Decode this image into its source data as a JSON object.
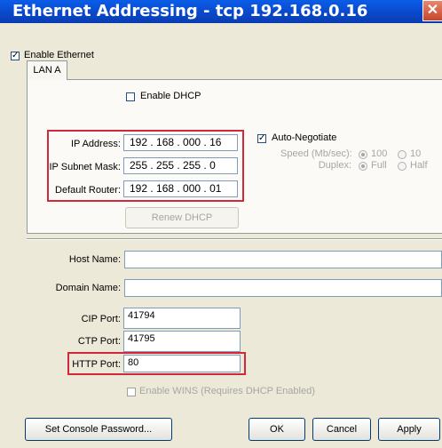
{
  "window": {
    "title": "Ethernet Addressing - tcp 192.168.0.16",
    "close_glyph": "✕"
  },
  "enable_ethernet": {
    "label": "Enable Ethernet",
    "checked": true
  },
  "tab": {
    "label": "LAN A"
  },
  "dhcp": {
    "label": "Enable DHCP",
    "checked": false
  },
  "ip_address": {
    "label": "IP Address:",
    "value": "192 . 168 . 000 . 16"
  },
  "subnet_mask": {
    "label": "IP Subnet Mask:",
    "value": "255 . 255 . 255 . 0"
  },
  "default_router": {
    "label": "Default Router:",
    "value": "192 . 168 . 000 . 01"
  },
  "renew_dhcp": {
    "label": "Renew DHCP"
  },
  "auto_negotiate": {
    "label": "Auto-Negotiate",
    "checked": true
  },
  "speed": {
    "label": "Speed (Mb/sec):",
    "options": [
      "100",
      "10"
    ],
    "selected": "100"
  },
  "duplex": {
    "label": "Duplex:",
    "options": [
      "Full",
      "Half"
    ],
    "selected": "Full"
  },
  "host_name": {
    "label": "Host Name:",
    "value": ""
  },
  "domain_name": {
    "label": "Domain Name:",
    "value": ""
  },
  "cip_port": {
    "label": "CIP Port:",
    "value": "41794"
  },
  "ctp_port": {
    "label": "CTP Port:",
    "value": "41795"
  },
  "http_port": {
    "label": "HTTP Port:",
    "value": "80"
  },
  "wins": {
    "label": "Enable WINS (Requires DHCP Enabled)",
    "checked": false
  },
  "buttons": {
    "console_password": "Set Console Password...",
    "ok": "OK",
    "cancel": "Cancel",
    "apply": "Apply"
  },
  "colors": {
    "highlight": "#d3283a",
    "titlebar": "#0a5de8"
  }
}
